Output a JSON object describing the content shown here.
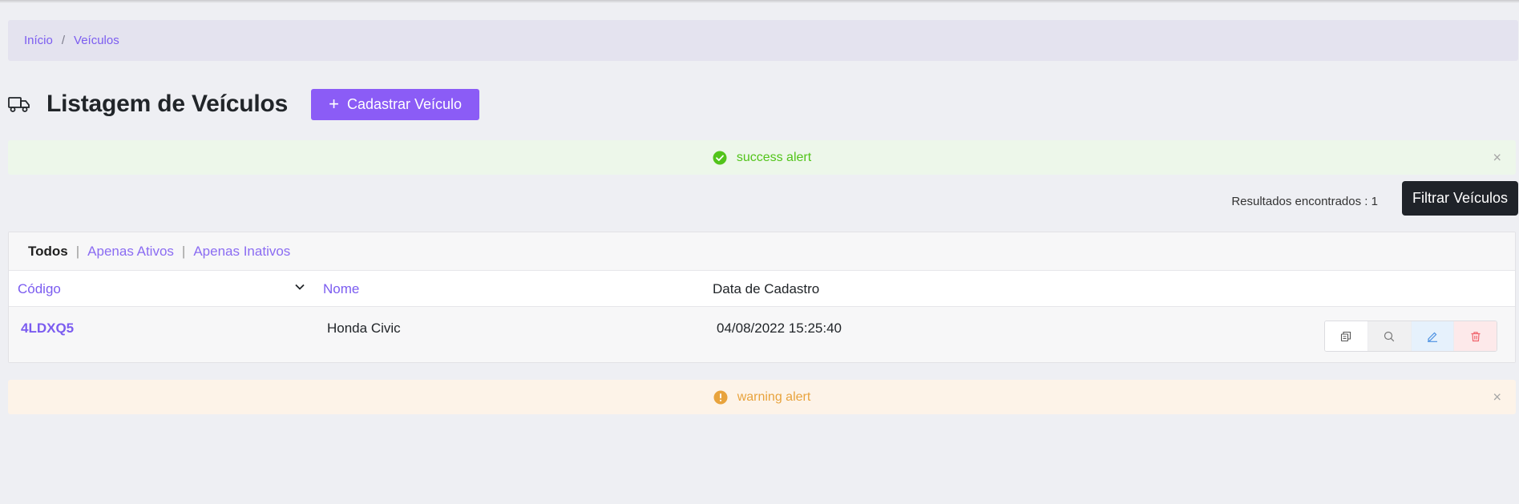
{
  "breadcrumb": {
    "home": "Início",
    "separator": "/",
    "current": "Veículos"
  },
  "header": {
    "icon": "truck-icon",
    "title": "Listagem de Veículos",
    "add_button_label": "Cadastrar Veículo"
  },
  "alerts": {
    "success": {
      "text": "success alert",
      "icon": "check-circle-icon",
      "color": "#52c41a"
    },
    "warning": {
      "text": "warning alert",
      "icon": "exclamation-circle-icon",
      "color": "#e8a33d"
    },
    "close_glyph": "×"
  },
  "results": {
    "text": "Resultados encontrados : 1",
    "filter_button_label": "Filtrar Veículos"
  },
  "filters": {
    "active": "Todos",
    "separator": "|",
    "options": [
      "Apenas Ativos",
      "Apenas Inativos"
    ]
  },
  "table": {
    "columns": [
      "Código",
      "Nome",
      "Data de Cadastro"
    ],
    "rows": [
      {
        "codigo": "4LDXQ5",
        "nome": "Honda Civic",
        "data": "04/08/2022 15:25:40"
      }
    ],
    "row_actions": [
      "copy-icon",
      "search-icon",
      "edit-icon",
      "trash-icon"
    ]
  },
  "colors": {
    "accent": "#8b5cf6",
    "link": "#7b5cf0",
    "dark_button": "#1f2329"
  }
}
